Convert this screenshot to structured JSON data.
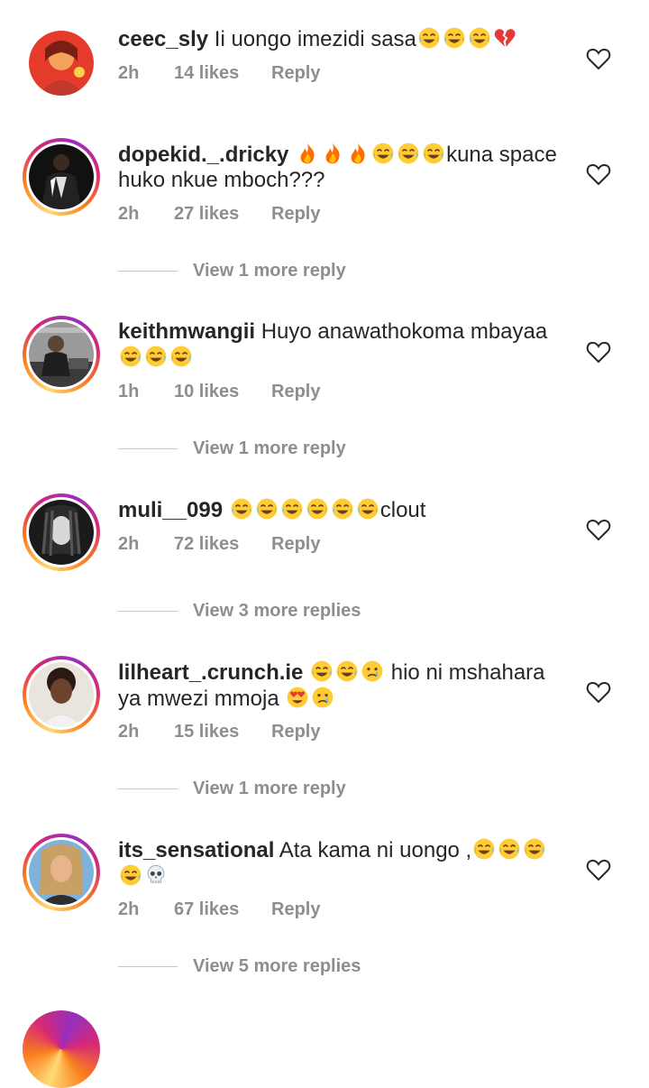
{
  "comments": [
    {
      "username": "ceec_sly",
      "text": "Ii uongo imezidi sasa",
      "emojis_after": [
        "laugh",
        "laugh",
        "laugh",
        "broken-heart"
      ],
      "time": "2h",
      "likes": "14 likes",
      "reply": "Reply",
      "view_more": ""
    },
    {
      "username": "dopekid._.dricky",
      "text_pre_emojis": [
        "fire",
        "fire",
        "fire",
        "laugh",
        "laugh",
        "laugh"
      ],
      "text": "kuna space huko nkue mboch???",
      "time": "2h",
      "likes": "27 likes",
      "reply": "Reply",
      "view_more": "View 1 more reply"
    },
    {
      "username": "keithmwangii",
      "text": "Huyo anawathokoma mbayaa",
      "emojis_after": [
        "laugh",
        "laugh",
        "laugh"
      ],
      "time": "1h",
      "likes": "10 likes",
      "reply": "Reply",
      "view_more": "View 1 more reply"
    },
    {
      "username": "muli__099",
      "text_pre_emojis": [
        "laugh",
        "laugh",
        "laugh",
        "laugh",
        "laugh",
        "laugh"
      ],
      "text": "clout",
      "time": "2h",
      "likes": "72 likes",
      "reply": "Reply",
      "view_more": "View 3 more replies"
    },
    {
      "username": "lilheart_.crunch.ie",
      "text_pre_emojis": [
        "laugh",
        "laugh",
        "cry"
      ],
      "text": "hio ni mshahara ya mwezi mmoja",
      "emojis_after": [
        "heart-eyes",
        "cry"
      ],
      "time": "2h",
      "likes": "15 likes",
      "reply": "Reply",
      "view_more": "View 1 more reply"
    },
    {
      "username": "its_sensational",
      "text": "Ata kama ni uongo ,",
      "emojis_after": [
        "laugh",
        "laugh",
        "laugh",
        "laugh",
        "skull"
      ],
      "time": "2h",
      "likes": "67 likes",
      "reply": "Reply",
      "view_more": "View 5 more replies"
    }
  ],
  "icons": {
    "like": "heart-outline-icon"
  },
  "colors": {
    "text": "#262626",
    "meta": "#8e8e8e",
    "ring_start": "#feda75",
    "ring_end": "#d62976"
  }
}
